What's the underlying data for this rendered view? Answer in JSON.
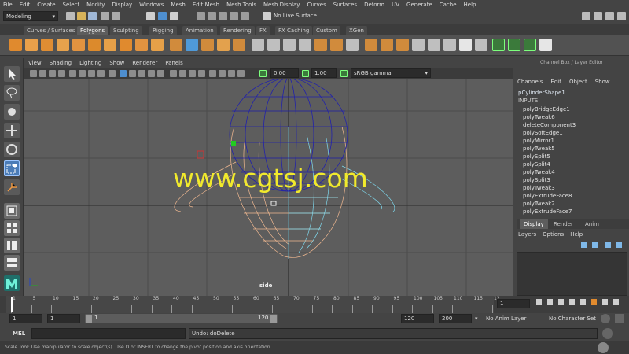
{
  "menubar": [
    "File",
    "Edit",
    "Create",
    "Select",
    "Modify",
    "Display",
    "Windows",
    "Mesh",
    "Edit Mesh",
    "Mesh Tools",
    "Mesh Display",
    "Curves",
    "Surfaces",
    "Deform",
    "UV",
    "Generate",
    "Cache",
    "Help"
  ],
  "toolbar": {
    "mode": "Modeling",
    "live_surface": "No Live Surface"
  },
  "shelf_tabs": [
    "Curves / Surfaces",
    "Polygons",
    "Sculpting",
    "Rigging",
    "Animation",
    "Rendering",
    "FX",
    "FX Caching",
    "Custom",
    "XGen"
  ],
  "active_shelf_tab": "Polygons",
  "panel_menu": [
    "View",
    "Shading",
    "Lighting",
    "Show",
    "Renderer",
    "Panels"
  ],
  "panel_tools": {
    "exposure": "0.00",
    "gamma": "1.00",
    "color_space": "sRGB gamma"
  },
  "viewport": {
    "camera_label": "side",
    "watermark": "www.cgtsj.com"
  },
  "channel_box": {
    "title": "Channel Box / Layer Editor",
    "menu": [
      "Channels",
      "Edit",
      "Object",
      "Show"
    ],
    "object": "pCylinderShape1",
    "inputs_header": "INPUTS",
    "inputs": [
      "polyBridgeEdge1",
      "polyTweak6",
      "deleteComponent3",
      "polySoftEdge1",
      "polyMirror1",
      "polyTweak5",
      "polySplit5",
      "polySplit4",
      "polyTweak4",
      "polySplit3",
      "polyTweak3",
      "polyExtrudeFace8",
      "polyTweak2",
      "polyExtrudeFace7"
    ]
  },
  "layer_editor": {
    "tabs": [
      "Display",
      "Render",
      "Anim"
    ],
    "active_tab": "Display",
    "menu": [
      "Layers",
      "Options",
      "Help"
    ]
  },
  "timeline": {
    "ticks": [
      "1",
      "5",
      "10",
      "15",
      "20",
      "25",
      "30",
      "35",
      "40",
      "45",
      "50",
      "55",
      "60",
      "65",
      "70",
      "75",
      "80",
      "85",
      "90",
      "95",
      "100",
      "105",
      "110",
      "115",
      "12"
    ],
    "current_frame": "1"
  },
  "range": {
    "start": "1",
    "start2": "1",
    "slider_start": "1",
    "slider_end": "120",
    "end": "120",
    "end2": "200",
    "anim_layer": "No Anim Layer",
    "char_set": "No Character Set"
  },
  "command_line": {
    "label": "MEL",
    "result": "Undo: doDelete"
  },
  "help_line": "Scale Tool: Use manipulator to scale object(s). Use D or INSERT to change the pivot position and axis orientation."
}
